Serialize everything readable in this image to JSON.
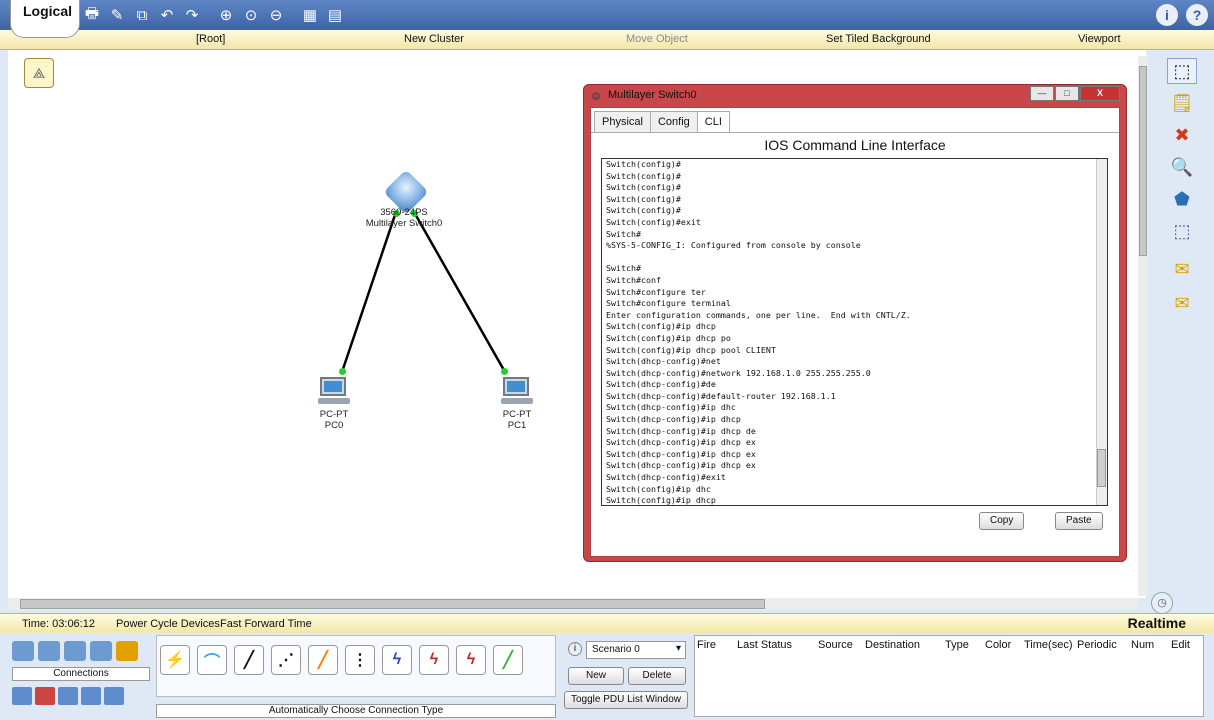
{
  "toolbar": {
    "icons": [
      "new-icon",
      "open-icon",
      "save-icon",
      "print-icon",
      "activity-wizard-icon",
      "copy-icon",
      "undo-icon",
      "redo-icon",
      "zoom-in-icon",
      "zoom-reset-icon",
      "zoom-out-icon",
      "palette-icon",
      "device-template-icon"
    ],
    "info": "i",
    "help": "?"
  },
  "logicalbar": {
    "tab": "Logical",
    "root": "[Root]",
    "new_cluster": "New Cluster",
    "move_object": "Move Object",
    "tiled_bg": "Set Tiled Background",
    "viewport": "Viewport"
  },
  "devices": {
    "switch": {
      "model": "3560-24PS",
      "name": "Multilayer Switch0"
    },
    "pc0": {
      "model": "PC-PT",
      "name": "PC0"
    },
    "pc1": {
      "model": "PC-PT",
      "name": "PC1"
    }
  },
  "cli_window": {
    "title": "Multilayer Switch0",
    "tabs": [
      "Physical",
      "Config",
      "CLI"
    ],
    "active_tab": "CLI",
    "heading": "IOS Command Line Interface",
    "console_text": "Switch(config)#\nSwitch(config)#\nSwitch(config)#\nSwitch(config)#\nSwitch(config)#\nSwitch(config)#exit\nSwitch#\n%SYS-5-CONFIG_I: Configured from console by console\n\nSwitch#\nSwitch#conf\nSwitch#configure ter\nSwitch#configure terminal\nEnter configuration commands, one per line.  End with CNTL/Z.\nSwitch(config)#ip dhcp\nSwitch(config)#ip dhcp po\nSwitch(config)#ip dhcp pool CLIENT\nSwitch(dhcp-config)#net\nSwitch(dhcp-config)#network 192.168.1.0 255.255.255.0\nSwitch(dhcp-config)#de\nSwitch(dhcp-config)#default-router 192.168.1.1\nSwitch(dhcp-config)#ip dhc\nSwitch(dhcp-config)#ip dhcp\nSwitch(dhcp-config)#ip dhcp de\nSwitch(dhcp-config)#ip dhcp ex\nSwitch(dhcp-config)#ip dhcp ex\nSwitch(dhcp-config)#ip dhcp ex\nSwitch(dhcp-config)#exit\nSwitch(config)#ip dhc\nSwitch(config)#ip dhcp",
    "copy": "Copy",
    "paste": "Paste",
    "min": "—",
    "max": "□",
    "close": "X"
  },
  "status": {
    "time": "Time: 03:06:12",
    "power_cycle": "Power Cycle Devices",
    "fast_forward": "Fast Forward Time",
    "mode": "Realtime"
  },
  "bottom": {
    "category_label": "Connections",
    "connection_caption": "Automatically Choose Connection Type",
    "cables": [
      {
        "name": "auto-connection",
        "glyph": "⚡",
        "color": "#e8a000"
      },
      {
        "name": "console",
        "glyph": "⌒",
        "color": "#3aa7d8"
      },
      {
        "name": "straight-through",
        "glyph": "╱",
        "color": "#111111"
      },
      {
        "name": "crossover",
        "glyph": "⋰",
        "color": "#111111"
      },
      {
        "name": "fiber",
        "glyph": "╱",
        "color": "#ff7a00"
      },
      {
        "name": "phone",
        "glyph": "⋮",
        "color": "#111111"
      },
      {
        "name": "coaxial",
        "glyph": "ϟ",
        "color": "#2b3dd6"
      },
      {
        "name": "serial-dce",
        "glyph": "ϟ",
        "color": "#d22020"
      },
      {
        "name": "serial-dte",
        "glyph": "ϟ",
        "color": "#d22020"
      },
      {
        "name": "octal",
        "glyph": "╱",
        "color": "#3ab03a"
      }
    ],
    "scenario": "Scenario 0",
    "new": "New",
    "delete": "Delete",
    "toggle_pdu": "Toggle PDU List Window",
    "pdu_headers": [
      "Fire",
      "Last Status",
      "Source",
      "Destination",
      "Type",
      "Color",
      "Time(sec)",
      "Periodic",
      "Num",
      "Edit"
    ]
  }
}
